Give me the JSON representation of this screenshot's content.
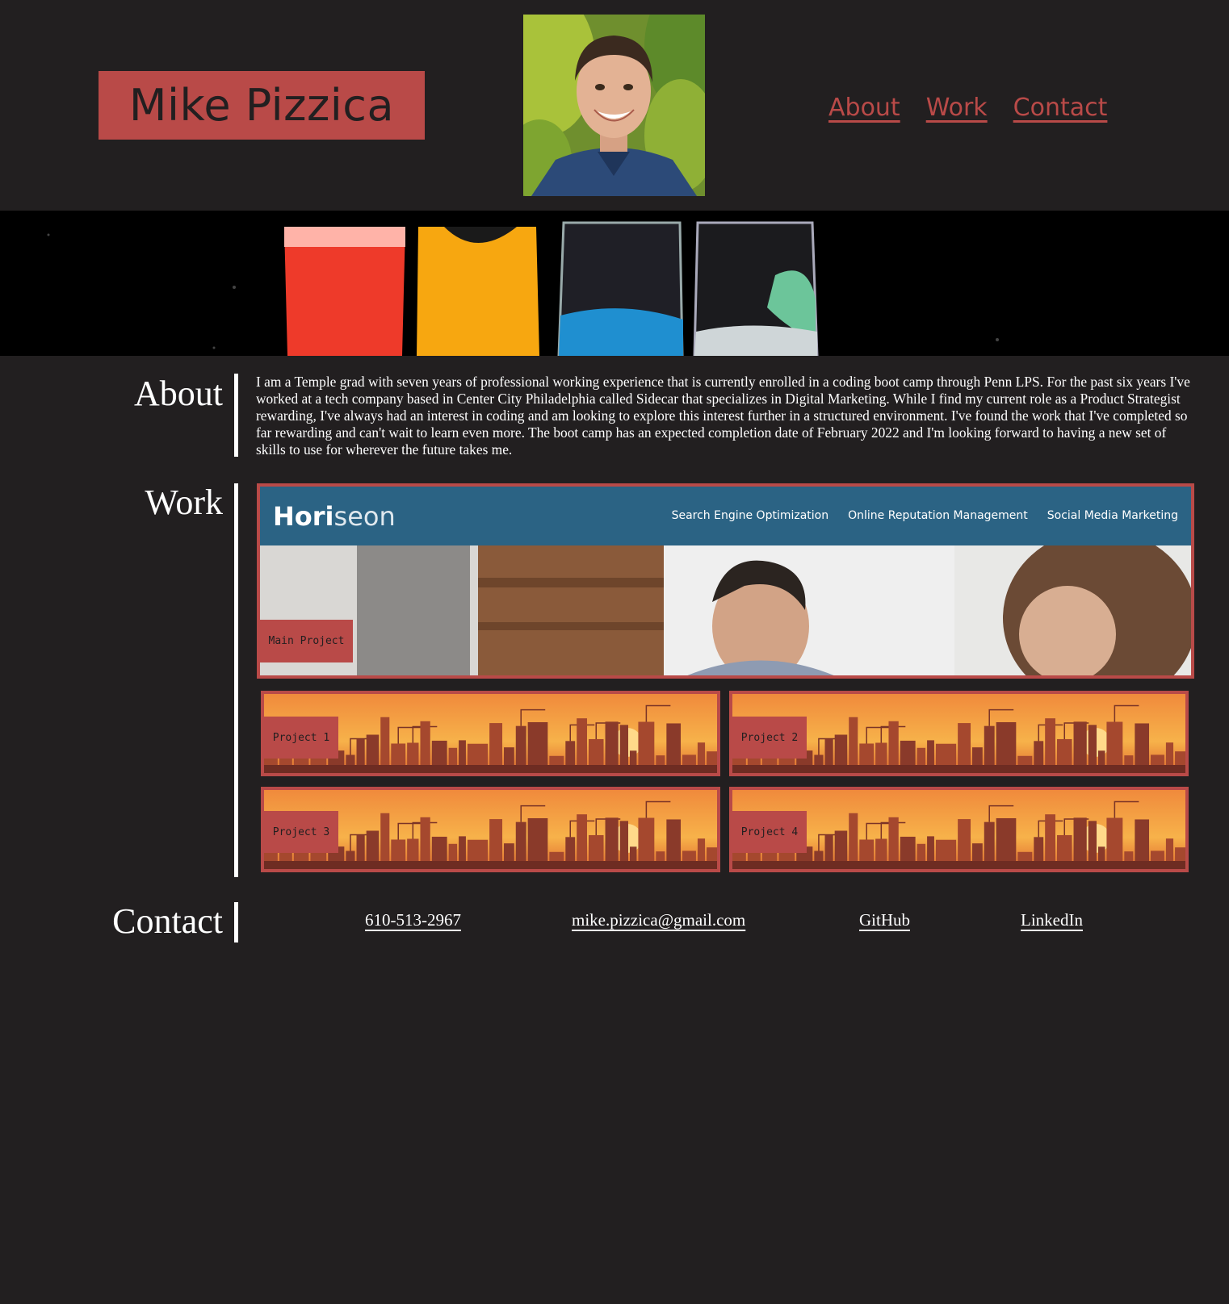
{
  "header": {
    "name": "Mike Pizzica",
    "nav": [
      "About",
      "Work",
      "Contact"
    ]
  },
  "about": {
    "title": "About",
    "text": "I am a Temple grad with seven years of professional working experience that is currently enrolled in a coding boot camp through Penn LPS. For the past six years I've worked at a tech company based in Center City Philadelphia called Sidecar that specializes in Digital Marketing. While I find my current role as a Product Strategist rewarding, I've always had an interest in coding and am looking to explore this interest further in a structured environment. I've found the work that I've completed so far rewarding and can't wait to learn even more. The boot camp has an expected completion date of February 2022 and I'm looking forward to having a new set of skills to use for wherever the future takes me."
  },
  "work": {
    "title": "Work",
    "main": {
      "label": "Main Project",
      "screenshot": {
        "logo_a": "Hori",
        "logo_b": "seon",
        "nav": [
          "Search Engine Optimization",
          "Online Reputation Management",
          "Social Media Marketing"
        ]
      }
    },
    "projects": [
      "Project 1",
      "Project 2",
      "Project 3",
      "Project 4"
    ]
  },
  "contact": {
    "title": "Contact",
    "links": [
      "610-513-2967",
      "mike.pizzica@gmail.com",
      "GitHub",
      "LinkedIn"
    ]
  },
  "colors": {
    "background": "#221f20",
    "accent": "#b94a48",
    "horiseon_bar": "#2b6384"
  }
}
